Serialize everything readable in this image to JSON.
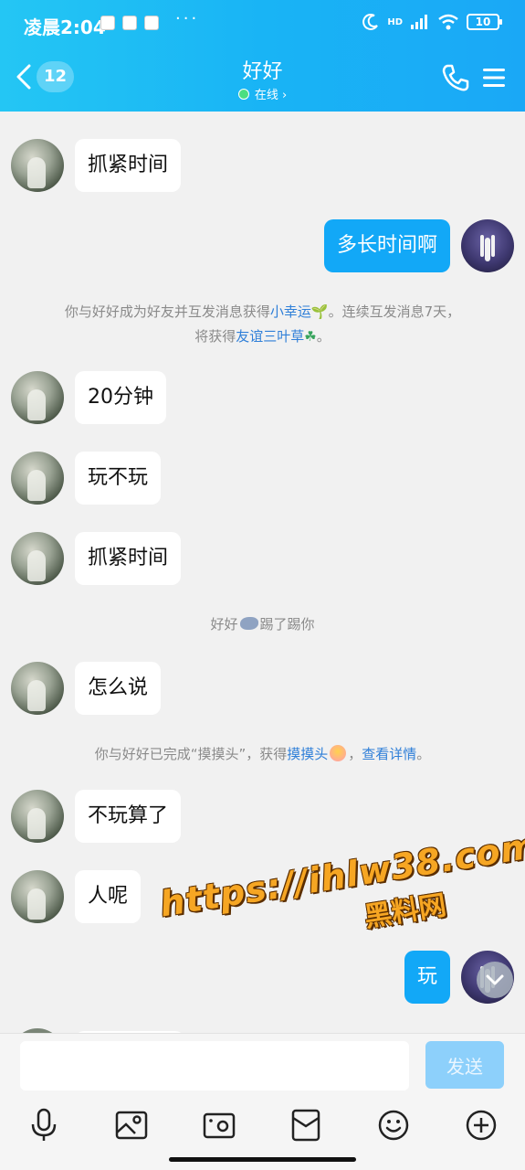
{
  "status_bar": {
    "time": "凌晨2:04",
    "dots": "···",
    "network": "HD",
    "battery": "10"
  },
  "header": {
    "unread_count": "12",
    "title": "好好",
    "status": "在线 ›",
    "accent": "#1ab4f5"
  },
  "messages": [
    {
      "side": "other",
      "text": "抓紧时间"
    },
    {
      "side": "self",
      "text": "多长时间啊"
    },
    {
      "side": "other",
      "text": "20分钟"
    },
    {
      "side": "other",
      "text": "玩不玩"
    },
    {
      "side": "other",
      "text": "抓紧时间"
    },
    {
      "side": "other",
      "text": "怎么说"
    },
    {
      "side": "other",
      "text": "不玩算了"
    },
    {
      "side": "other",
      "text": "人呢"
    },
    {
      "side": "self",
      "text": "玩"
    }
  ],
  "system": {
    "lucky_line1_a": "你与好好成为好友并互发消息获得",
    "lucky_link": "小幸运",
    "lucky_line1_b": "。连续互发消息7天，",
    "lucky_line2_a": "将获得",
    "lucky_link2": "友谊三叶草",
    "lucky_line2_b": "。",
    "kick_a": "好好",
    "kick_b": "踢了踢你",
    "pat_a": "你与好好已完成“摸摸头”，获得",
    "pat_link": "摸摸头",
    "pat_b": "，",
    "pat_details": "查看详情",
    "pat_c": "。"
  },
  "watermark": {
    "url": "https://ihlw38.com",
    "sub": "黑料网"
  },
  "input": {
    "value": "",
    "send_label": "发送"
  },
  "toolbar": [
    "voice-icon",
    "image-icon",
    "camera-icon",
    "red-packet-icon",
    "emoji-icon",
    "plus-icon"
  ]
}
